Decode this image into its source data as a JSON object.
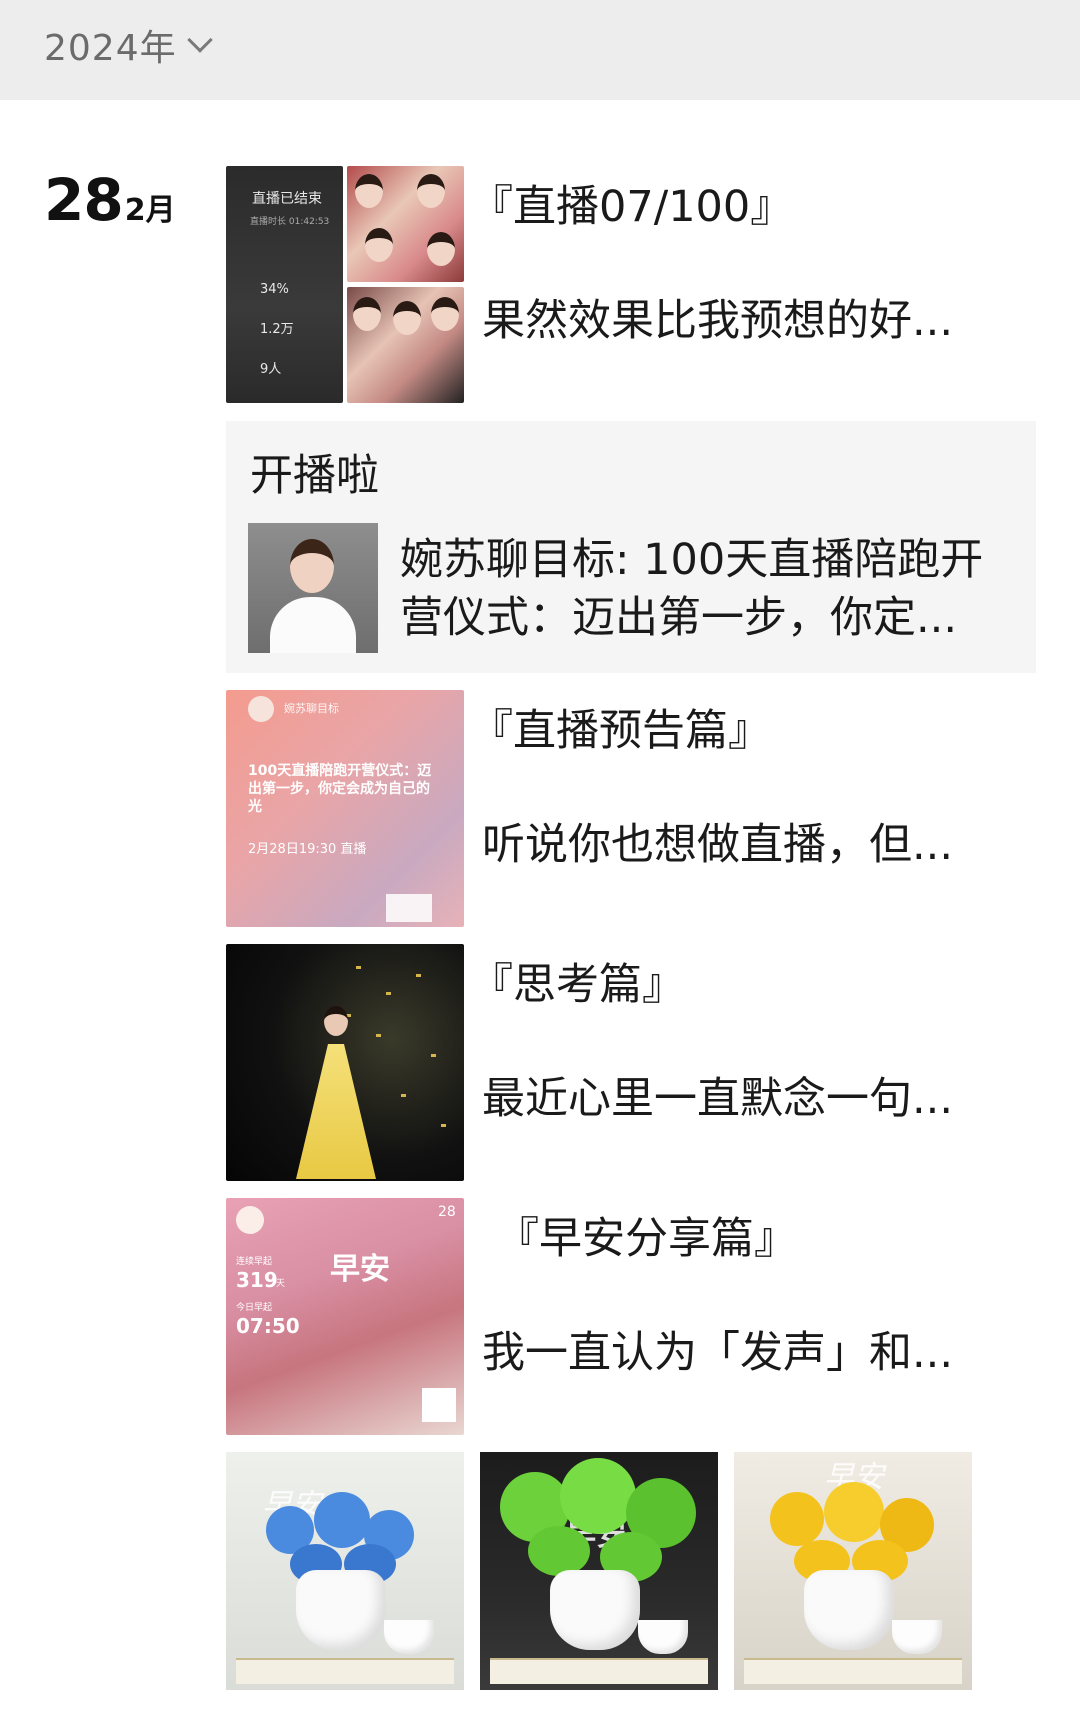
{
  "header": {
    "year_label": "2024年"
  },
  "date": {
    "day": "28",
    "month": "2月"
  },
  "posts": [
    {
      "title": "『直播07/100』",
      "excerpt": "果然效果比我预想的好...",
      "thumb_text": {
        "heading": "直播已结束",
        "sub": "直播时长 01:42:53",
        "stat1": "34%",
        "stat2": "1.2万",
        "stat3": "9人"
      }
    },
    {
      "title": "『直播预告篇』",
      "excerpt": "听说你也想做直播，但...",
      "thumb_text": {
        "account": "婉苏聊目标",
        "headline": "100天直播陪跑开营仪式：迈出第一步，你定会成为自己的光",
        "time": "2月28日19:30 直播"
      }
    },
    {
      "title": "『思考篇』",
      "excerpt": "最近心里一直默念一句..."
    },
    {
      "title": "『早安分享篇』",
      "excerpt": "我一直认为「发声」和...",
      "thumb_text": {
        "date_num": "28",
        "greeting": "早安",
        "streak_label": "连续早起",
        "streak_value": "319",
        "streak_unit": "天",
        "wake_label": "今日早起",
        "wake_time": "07:50"
      }
    }
  ],
  "live_card": {
    "title": "开播啦",
    "description": "婉苏聊目标: 100天直播陪跑开营仪式：迈出第一步，你定..."
  },
  "flower_posts": [
    {
      "caption": "早安",
      "flower_color": "#4a8be0"
    },
    {
      "caption": "早安",
      "flower_color": "#6cd13a"
    },
    {
      "caption": "早安",
      "flower_color": "#f4c21d"
    }
  ]
}
